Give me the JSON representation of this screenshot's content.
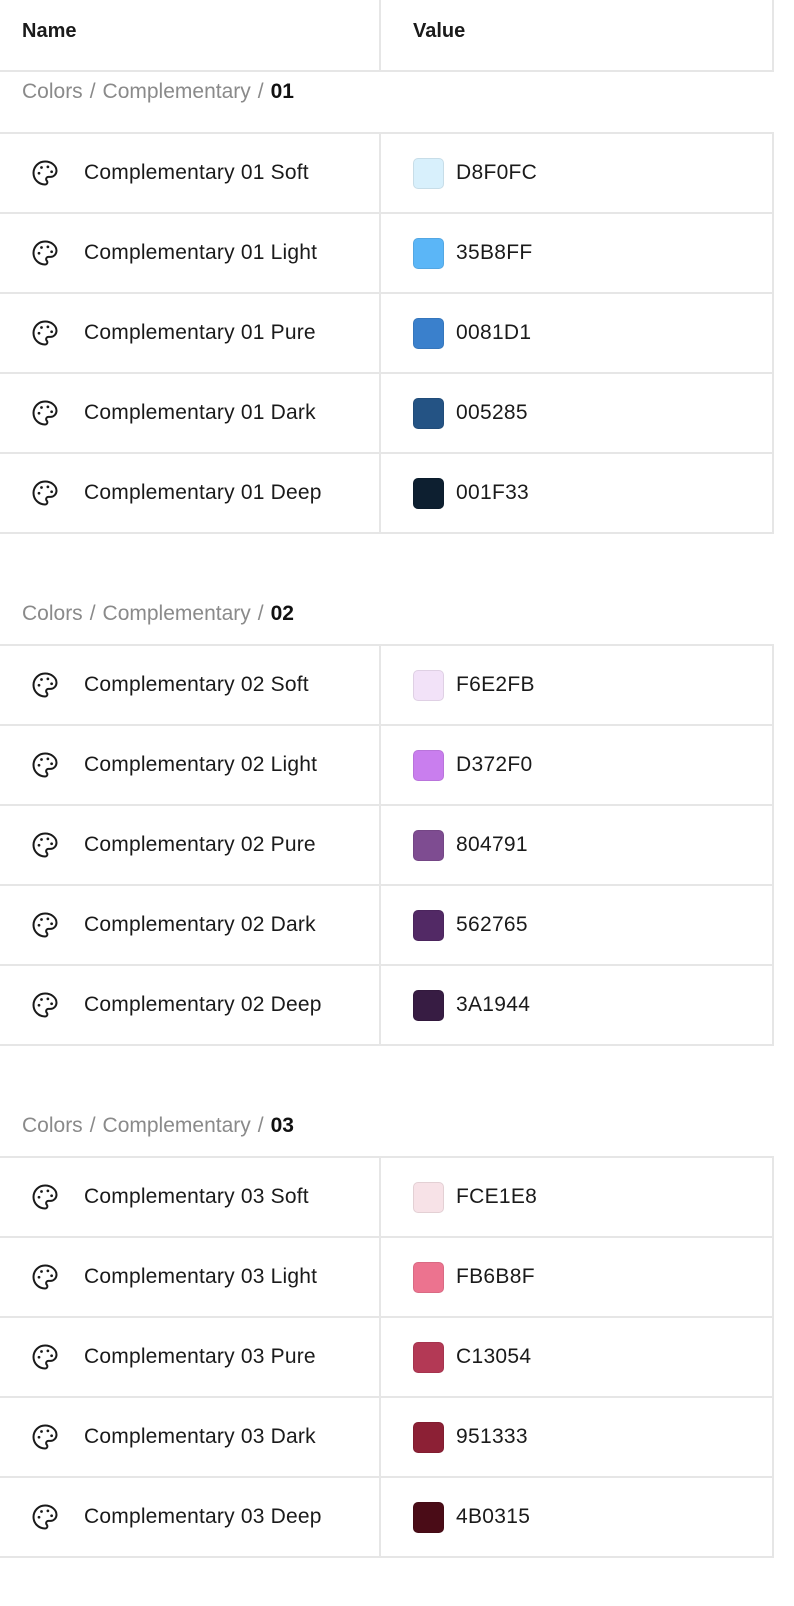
{
  "header": {
    "name_label": "Name",
    "value_label": "Value"
  },
  "groups": [
    {
      "breadcrumb": [
        "Colors",
        "Complementary",
        "01"
      ],
      "items": [
        {
          "name": "Complementary 01 Soft",
          "hex": "D8F0FC",
          "color": "#D8F0FC",
          "icon": "palette-icon"
        },
        {
          "name": "Complementary 01 Light",
          "hex": "35B8FF",
          "color": "#5BB6F7",
          "icon": "palette-icon"
        },
        {
          "name": "Complementary 01 Pure",
          "hex": "0081D1",
          "color": "#3A80CC",
          "icon": "palette-icon"
        },
        {
          "name": "Complementary 01 Dark",
          "hex": "005285",
          "color": "#245384",
          "icon": "palette-icon"
        },
        {
          "name": "Complementary 01 Deep",
          "hex": "001F33",
          "color": "#0D1F30",
          "icon": "palette-icon"
        }
      ]
    },
    {
      "breadcrumb": [
        "Colors",
        "Complementary",
        "02"
      ],
      "items": [
        {
          "name": "Complementary 02 Soft",
          "hex": "F6E2FB",
          "color": "#F2E2F8",
          "icon": "palette-icon"
        },
        {
          "name": "Complementary 02 Light",
          "hex": "D372F0",
          "color": "#C97EEE",
          "icon": "palette-icon"
        },
        {
          "name": "Complementary 02 Pure",
          "hex": "804791",
          "color": "#7E4C91",
          "icon": "palette-icon"
        },
        {
          "name": "Complementary 02 Dark",
          "hex": "562765",
          "color": "#522965",
          "icon": "palette-icon"
        },
        {
          "name": "Complementary 02 Deep",
          "hex": "3A1944",
          "color": "#371C43",
          "icon": "palette-icon"
        }
      ]
    },
    {
      "breadcrumb": [
        "Colors",
        "Complementary",
        "03"
      ],
      "items": [
        {
          "name": "Complementary 03 Soft",
          "hex": "FCE1E8",
          "color": "#F7E2E7",
          "icon": "palette-icon"
        },
        {
          "name": "Complementary 03 Light",
          "hex": "FB6B8F",
          "color": "#EC738F",
          "icon": "palette-icon"
        },
        {
          "name": "Complementary 03 Pure",
          "hex": "C13054",
          "color": "#B33955",
          "icon": "palette-icon"
        },
        {
          "name": "Complementary 03 Dark",
          "hex": "951333",
          "color": "#8C2035",
          "icon": "palette-icon"
        },
        {
          "name": "Complementary 03 Deep",
          "hex": "4B0315",
          "color": "#4A0C17",
          "icon": "palette-icon"
        }
      ]
    }
  ]
}
